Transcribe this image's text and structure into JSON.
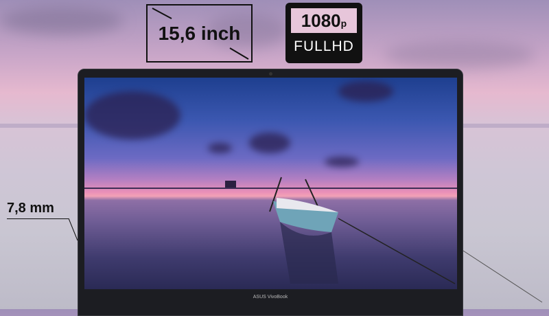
{
  "specs": {
    "screen_size": "15,6 inch",
    "resolution_main": "1080",
    "resolution_suffix": "p",
    "resolution_label": "FULLHD",
    "thickness": "7,8 mm"
  },
  "laptop": {
    "brand": "ASUS VivoBook"
  }
}
